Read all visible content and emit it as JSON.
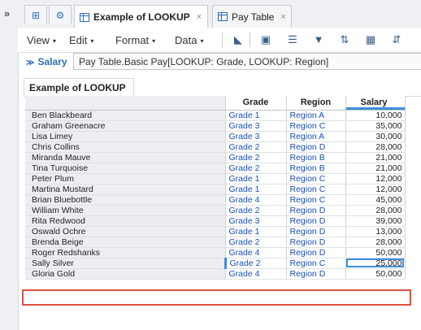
{
  "sidebar": {
    "expand_icon": "double-chevron-right-icon",
    "expand_glyph": "»"
  },
  "tabs": {
    "grid_icon": "grid-view-icon",
    "grid_glyph": "⊞",
    "settings_icon": "gear-icon",
    "settings_glyph": "⚙",
    "items": [
      {
        "label": "Example of LOOKUP",
        "active": true,
        "close": "×"
      },
      {
        "label": "Pay Table",
        "active": false,
        "close": "×"
      }
    ]
  },
  "toolbar": {
    "menus": [
      {
        "label": "View"
      },
      {
        "label": "Edit"
      },
      {
        "label": "Format"
      },
      {
        "label": "Data"
      }
    ],
    "caret": "▾",
    "icons": [
      {
        "name": "chart-icon",
        "glyph": "◣"
      },
      {
        "name": "frame-icon",
        "glyph": "▣"
      },
      {
        "name": "align-icon",
        "glyph": "☰"
      },
      {
        "name": "filter-icon",
        "glyph": "▼"
      },
      {
        "name": "sort-icon",
        "glyph": "⇅"
      },
      {
        "name": "table-icon",
        "glyph": "▦"
      },
      {
        "name": "more-icon",
        "glyph": "⇵"
      }
    ]
  },
  "formula": {
    "chevron": "≫",
    "label": "Salary",
    "value": "Pay Table.Basic Pay[LOOKUP: Grade, LOOKUP: Region]"
  },
  "view_tab": {
    "label": "Example of LOOKUP"
  },
  "table": {
    "headers": {
      "name": "",
      "grade": "Grade",
      "region": "Region",
      "salary": "Salary"
    },
    "rows": [
      {
        "name": "Ben Blackbeard",
        "grade": "Grade 1",
        "region": "Region A",
        "salary": "10,000"
      },
      {
        "name": "Graham Greenacre",
        "grade": "Grade 3",
        "region": "Region C",
        "salary": "35,000"
      },
      {
        "name": "Lisa Limey",
        "grade": "Grade 3",
        "region": "Region A",
        "salary": "30,000"
      },
      {
        "name": "Chris Collins",
        "grade": "Grade 2",
        "region": "Region D",
        "salary": "28,000"
      },
      {
        "name": "Miranda Mauve",
        "grade": "Grade 2",
        "region": "Region B",
        "salary": "21,000"
      },
      {
        "name": "Tina Turquoise",
        "grade": "Grade 2",
        "region": "Region B",
        "salary": "21,000"
      },
      {
        "name": "Peter Plum",
        "grade": "Grade 1",
        "region": "Region C",
        "salary": "12,000"
      },
      {
        "name": "Martina Mustard",
        "grade": "Grade 1",
        "region": "Region C",
        "salary": "12,000"
      },
      {
        "name": "Brian Bluebottle",
        "grade": "Grade 4",
        "region": "Region C",
        "salary": "45,000"
      },
      {
        "name": "William White",
        "grade": "Grade 2",
        "region": "Region D",
        "salary": "28,000"
      },
      {
        "name": "Rita Redwood",
        "grade": "Grade 3",
        "region": "Region D",
        "salary": "39,000"
      },
      {
        "name": "Oswald Ochre",
        "grade": "Grade 1",
        "region": "Region D",
        "salary": "13,000"
      },
      {
        "name": "Brenda Beige",
        "grade": "Grade 2",
        "region": "Region D",
        "salary": "28,000"
      },
      {
        "name": "Roger Redshanks",
        "grade": "Grade 4",
        "region": "Region D",
        "salary": "50,000"
      },
      {
        "name": "Sally Silver",
        "grade": "Grade 2",
        "region": "Region C",
        "salary": "25,000",
        "selected": true
      },
      {
        "name": "Gloria Gold",
        "grade": "Grade 4",
        "region": "Region D",
        "salary": "50,000"
      }
    ]
  },
  "colors": {
    "accent": "#3c8fdb",
    "link": "#1a4fb5",
    "highlight": "#e0503f"
  }
}
